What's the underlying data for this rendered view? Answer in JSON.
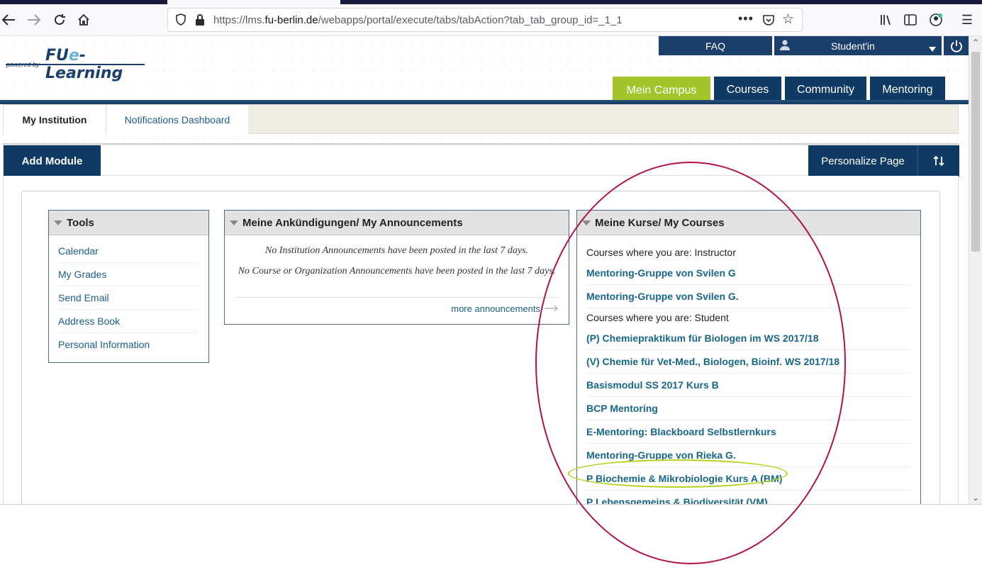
{
  "browser": {
    "url_prefix": "https://lms.",
    "url_host": "fu-berlin.de",
    "url_path": "/webapps/portal/execute/tabs/tabAction?tab_tab_group_id=_1_1"
  },
  "header": {
    "logo_powered": "powered by",
    "logo_fu": "FU",
    "logo_e": "e",
    "logo_rest": "-Learning",
    "faq_label": "FAQ",
    "user_label": "Student'in"
  },
  "main_tabs": [
    "Mein Campus",
    "Courses",
    "Community",
    "Mentoring"
  ],
  "sub_tabs": [
    "My Institution",
    "Notifications Dashboard"
  ],
  "actions": {
    "add_module": "Add Module",
    "personalize": "Personalize Page"
  },
  "tools": {
    "title": "Tools",
    "items": [
      "Calendar",
      "My Grades",
      "Send Email",
      "Address Book",
      "Personal Information"
    ]
  },
  "announcements": {
    "title": "Meine Ankündigungen/ My Announcements",
    "line1": "No Institution Announcements have been posted in the last 7 days.",
    "line2": "No Course or Organization Announcements have been posted in the last 7 days.",
    "more": "more announcements"
  },
  "courses": {
    "title": "Meine Kurse/ My Courses",
    "instructor_heading": "Courses where you are: Instructor",
    "instructor": [
      "Mentoring-Gruppe von Svilen G",
      "Mentoring-Gruppe von Svilen G."
    ],
    "student_heading": "Courses where you are: Student",
    "student": [
      "(P) Chemiepraktikum für Biologen im WS 2017/18",
      "(V) Chemie für Vet-Med., Biologen, Bioinf. WS 2017/18",
      "Basismodul SS 2017 Kurs B",
      "BCP Mentoring",
      "E-Mentoring: Blackboard Selbstlernkurs",
      "Mentoring-Gruppe von Rieka G.",
      "P Biochemie & Mikrobiologie Kurs A (BM)",
      "P Lebensgemeins & Biodiversität (VM)"
    ]
  },
  "colors": {
    "navy": "#0e3a63",
    "active_tab": "#a3c52a",
    "link": "#17668a",
    "ellipse_red": "#b0124a",
    "ellipse_green": "#b7cf1f"
  }
}
